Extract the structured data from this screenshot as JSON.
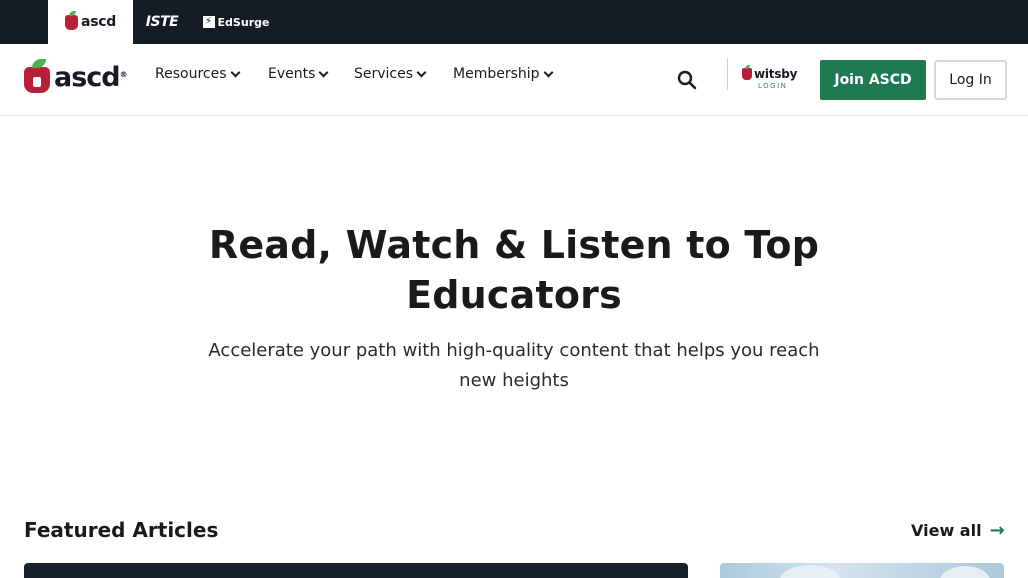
{
  "brandbar": {
    "brands": [
      {
        "label": "ascd",
        "active": true
      },
      {
        "label": "ISTE",
        "active": false
      },
      {
        "label": "EdSurge",
        "active": false
      }
    ]
  },
  "nav": {
    "logo_text": "ascd",
    "logo_reg": "®",
    "items": [
      {
        "label": "Resources"
      },
      {
        "label": "Events"
      },
      {
        "label": "Services"
      },
      {
        "label": "Membership"
      }
    ],
    "witsby": {
      "name": "witsby",
      "sub": "LOGIN"
    },
    "join_label": "Join ASCD",
    "login_label": "Log In"
  },
  "hero": {
    "title": "Read, Watch & Listen to Top Educators",
    "subtitle": "Accelerate your path with high-quality content that helps you reach new heights"
  },
  "featured": {
    "title": "Featured Articles",
    "view_all": "View all"
  },
  "colors": {
    "brandbar_bg": "#151c26",
    "accent_green": "#1f7a52",
    "brand_red": "#b8203a"
  },
  "icons": [
    "search-icon",
    "chevron-down-icon",
    "arrow-right-icon"
  ]
}
